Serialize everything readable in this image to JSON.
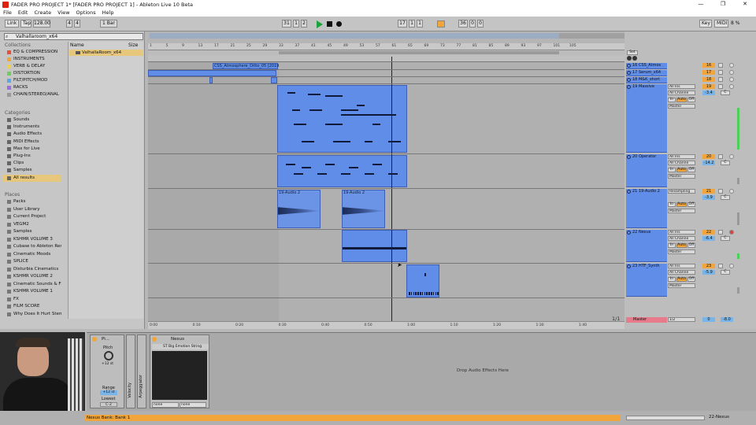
{
  "window": {
    "title": "FADER PRO PROJECT 1*  [FADER PRO PROJECT 1] - Ableton Live 10 Beta",
    "minimize": "—",
    "restore": "❐",
    "close": "✕"
  },
  "menu": [
    "File",
    "Edit",
    "Create",
    "View",
    "Options",
    "Help"
  ],
  "transport": {
    "link": "Link",
    "tap": "Tap",
    "tempo": "128.00",
    "sig_num": "4",
    "sig_den": "4",
    "quant": "1 Bar",
    "pos_bars": "31",
    "pos_beats": "1",
    "pos_sixteenth": "2",
    "loop_start_bars": "17",
    "loop_start_beats": "1",
    "loop_start_sixteenth": "1",
    "loop_len_bars": "36",
    "loop_len_beats": "0",
    "loop_len_sixteenth": "0",
    "key": "Key",
    "midi": "MIDI",
    "cpu": "8 %"
  },
  "browser": {
    "search_value": "Valhallaroom_x64",
    "collections_header": "Collections",
    "collections": [
      {
        "label": "EQ & COMPRESSION",
        "color": "#e8503a"
      },
      {
        "label": "INSTRUMENTS",
        "color": "#f2a53a"
      },
      {
        "label": "VERB & DELAY",
        "color": "#eed04a"
      },
      {
        "label": "DISTORTION",
        "color": "#6bd05a"
      },
      {
        "label": "FILT/PITCH/MOD",
        "color": "#5aa8e8"
      },
      {
        "label": "RACKS",
        "color": "#9a6ee0"
      },
      {
        "label": "CHAIN/STEREO/ANAL",
        "color": "#999999"
      }
    ],
    "categories_header": "Categories",
    "categories": [
      "Sounds",
      "Instruments",
      "Audio Effects",
      "MIDI Effects",
      "Max for Live",
      "Plug-Ins",
      "Clips",
      "Samples",
      "All results"
    ],
    "places_header": "Places",
    "places": [
      "Packs",
      "User Library",
      "Current Project",
      "VEGM2",
      "Samples",
      "KSHMR VOLUME 3",
      "Cubase to Ableton Rend",
      "Cinematic Moods",
      "SPLICE",
      "Disturbia Cinematics",
      "KSHMR VOLUME 2",
      "Cinematic Sounds & FX",
      "KSHMR VOLUME 1",
      "FX",
      "FILM SCORE",
      "Why Does It Hurt Stems"
    ],
    "col_name": "Name",
    "col_size": "Size",
    "result": "ValhallaRoom_x64"
  },
  "ruler": {
    "bars": [
      "1",
      "5",
      "9",
      "13",
      "17",
      "21",
      "25",
      "29",
      "33",
      "37",
      "41",
      "45",
      "49",
      "53",
      "57",
      "61",
      "65",
      "69",
      "73",
      "77",
      "81",
      "85",
      "89",
      "93",
      "97",
      "101",
      "105"
    ],
    "times": [
      "0:00",
      "0:10",
      "0:20",
      "0:30",
      "0:40",
      "0:50",
      "1:00",
      "1:10",
      "1:20",
      "1:30",
      "1:40"
    ],
    "set": "Set",
    "page": "1/1"
  },
  "clips": {
    "atmos": "CSS_Atmosphere_Ditto_05 [2019",
    "audio_a": "19-Audio 2",
    "audio_b": "19-Audio 2"
  },
  "tracks": [
    {
      "name": "16 CSS_Atmos",
      "num": "16"
    },
    {
      "name": "17 Serum_x64",
      "num": "17"
    },
    {
      "name": "18 M&K_short",
      "num": "18"
    },
    {
      "name": "19 Massive",
      "num": "19",
      "input": "All Ins",
      "chan": "All Channe",
      "monitor_in": "In",
      "monitor_auto": "Auto",
      "monitor_off": "Off",
      "out": "Master",
      "vol": "-3.4",
      "pan": "C"
    },
    {
      "name": "20 Operator",
      "num": "20",
      "input": "All Ins",
      "chan": "All Channe",
      "monitor_in": "In",
      "monitor_auto": "Auto",
      "monitor_off": "Off",
      "out": "Master",
      "vol": "-14.2",
      "pan": "C"
    },
    {
      "name": "21 19-Audio 2",
      "num": "21",
      "input": "Resampling",
      "chan": "",
      "monitor_in": "In",
      "monitor_auto": "Auto",
      "monitor_off": "Off",
      "out": "Master",
      "vol": "-3.9",
      "pan": "C"
    },
    {
      "name": "22 Nexus",
      "num": "22",
      "input": "All Ins",
      "chan": "All Channe",
      "monitor_in": "In",
      "monitor_auto": "Auto",
      "monitor_off": "Off",
      "out": "Master",
      "vol": "-6.4",
      "pan": "C"
    },
    {
      "name": "23 HTF_Synth",
      "num": "23",
      "input": "All Ins",
      "chan": "All Channe",
      "monitor_in": "In",
      "monitor_auto": "Auto",
      "monitor_off": "Off",
      "out": "Master",
      "vol": "-5.9",
      "pan": "C"
    }
  ],
  "master": {
    "name": "Master",
    "out": "1/2",
    "num": "0",
    "vol": "-8.0"
  },
  "devices": {
    "pitch_title": "Pi...",
    "pitch_label": "Pitch",
    "pitch_value": "+12 st",
    "range_label": "Range",
    "range_value": "+12 st",
    "lowest_label": "Lowest",
    "lowest_value": "C-2",
    "velocity": "Velocity",
    "arpeggiator": "Arpeggiator",
    "nexus_title": "Nexus",
    "nexus_preset": "ST Big Emotion String",
    "none_a": "none",
    "none_b": "none",
    "drop": "Drop Audio Effects Here"
  },
  "status": {
    "left": "Nexus Bank: Bank 1",
    "right": "22-Nexus"
  }
}
